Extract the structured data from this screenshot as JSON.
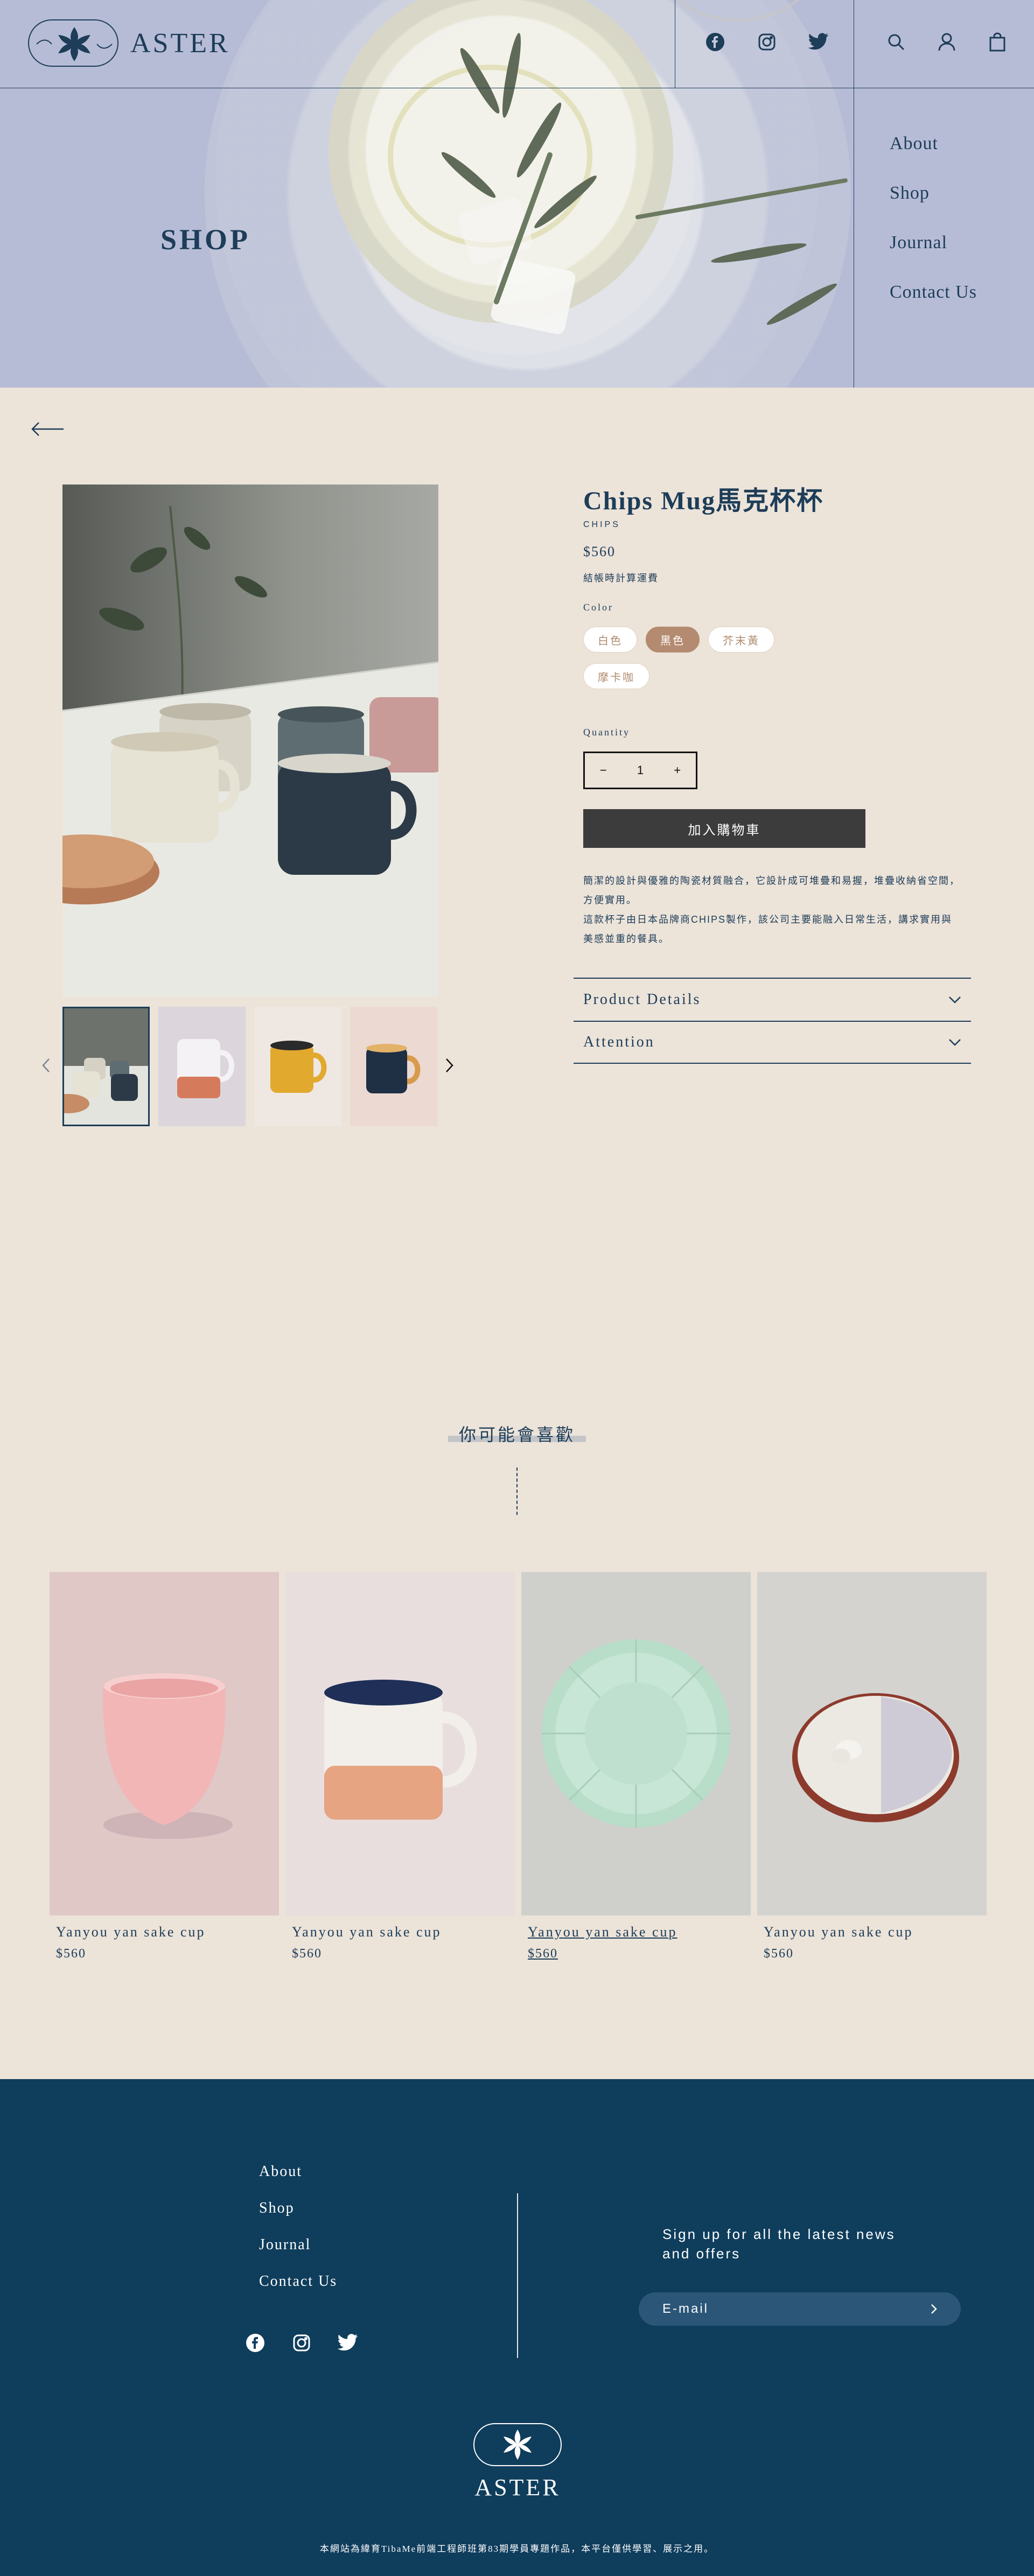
{
  "brand": {
    "name": "ASTER"
  },
  "hero": {
    "title": "SHOP"
  },
  "nav": {
    "menu": [
      "About",
      "Shop",
      "Journal",
      "Contact Us"
    ]
  },
  "product": {
    "title": "Chips Mug馬克杯杯",
    "brand": "CHIPS",
    "price": "$560",
    "shipping_note": "結帳時計算運費",
    "color_label": "Color",
    "colors": [
      "白色",
      "黑色",
      "芥末黃",
      "摩卡咖"
    ],
    "selected_color": "黑色",
    "quantity_label": "Quantity",
    "quantity": "1",
    "qty_minus": "−",
    "qty_plus": "+",
    "add_to_cart": "加入購物車",
    "description": [
      "簡潔的設計與優雅的陶瓷材質融合，它設計成可堆疊和易握，堆疊收納省空間，方便實用。",
      "這款杯子由日本品牌商CHIPS製作，該公司主要能融入日常生活，講求實用與美感並重的餐具。"
    ],
    "accordions": [
      "Product Details",
      "Attention"
    ]
  },
  "related": {
    "title": "你可能會喜歡",
    "items": [
      {
        "name": "Yanyou yan sake cup",
        "price": "$560"
      },
      {
        "name": "Yanyou yan sake cup",
        "price": "$560"
      },
      {
        "name": "Yanyou yan sake cup",
        "price": "$560"
      },
      {
        "name": "Yanyou yan sake cup",
        "price": "$560"
      }
    ]
  },
  "footer": {
    "links": [
      "About",
      "Shop",
      "Journal",
      "Contact Us"
    ],
    "newsletter": "Sign up for all the latest news and offers",
    "email_placeholder": "E-mail",
    "logo_text": "ASTER",
    "copyright": "本網站為緯育TibaMe前端工程師班第83期學員專題作品，本平台僅供學習、展示之用。"
  },
  "colors": {
    "navy": "#1d3d58",
    "cream": "#ece3d9",
    "footer": "#0f3d5c",
    "accent": "#b48b70",
    "button": "#3c3c3c"
  },
  "icons": [
    "facebook-icon",
    "instagram-icon",
    "twitter-icon",
    "search-icon",
    "user-icon",
    "cart-icon",
    "back-arrow-icon",
    "chevron-left-icon",
    "chevron-right-icon",
    "chevron-down-icon"
  ]
}
